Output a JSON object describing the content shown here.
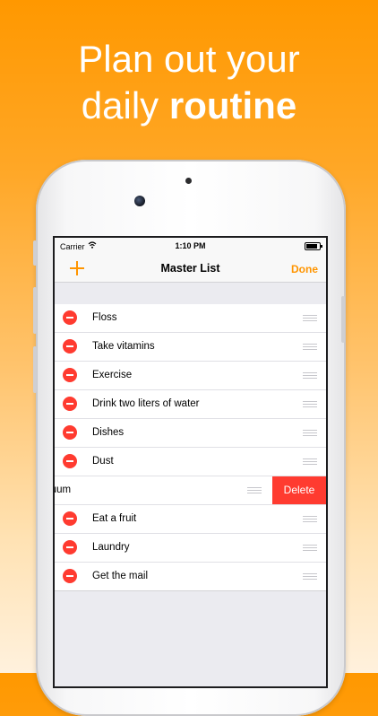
{
  "headline": {
    "line1": "Plan out your",
    "line2_prefix": "daily ",
    "line2_bold": "routine"
  },
  "status_bar": {
    "carrier": "Carrier",
    "time": "1:10 PM"
  },
  "nav": {
    "add_icon": "plus-icon",
    "title": "Master List",
    "done_label": "Done"
  },
  "list": {
    "items": [
      {
        "label": "Floss"
      },
      {
        "label": "Take vitamins"
      },
      {
        "label": "Exercise"
      },
      {
        "label": "Drink two liters of water"
      },
      {
        "label": "Dishes"
      },
      {
        "label": "Dust"
      },
      {
        "label": "cuum",
        "swiped": true
      },
      {
        "label": "Eat a fruit"
      },
      {
        "label": "Laundry"
      },
      {
        "label": "Get the mail"
      }
    ],
    "delete_label": "Delete"
  },
  "colors": {
    "accent": "#ff9500",
    "destructive": "#ff3b30",
    "background_top": "#ff9800",
    "background_bottom": "#fff1dd"
  }
}
